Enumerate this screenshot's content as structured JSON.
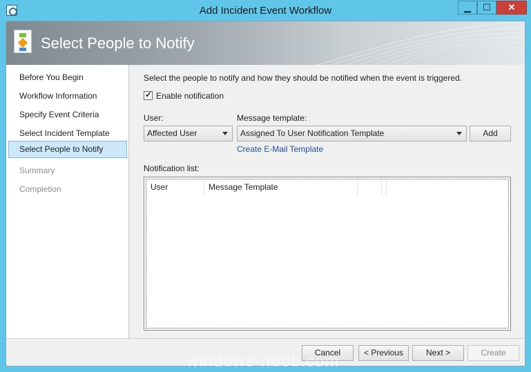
{
  "window": {
    "title": "Add Incident Event Workflow",
    "controls": {
      "minimize": "▁",
      "maximize": "☐",
      "close": "✕"
    }
  },
  "banner": {
    "title": "Select People to Notify"
  },
  "nav": {
    "items": [
      {
        "label": "Before You Begin",
        "state": "normal"
      },
      {
        "label": "Workflow Information",
        "state": "normal"
      },
      {
        "label": "Specify Event Criteria",
        "state": "normal"
      },
      {
        "label": "Select Incident Template",
        "state": "normal"
      },
      {
        "label": "Select People to Notify",
        "state": "active"
      },
      {
        "label": "Summary",
        "state": "disabled"
      },
      {
        "label": "Completion",
        "state": "disabled"
      }
    ]
  },
  "main": {
    "description": "Select the people to notify and how they should be notified when the event is triggered.",
    "enable_notification": {
      "label": "Enable notification",
      "checked": true
    },
    "user_label": "User:",
    "user_value": "Affected User",
    "template_label": "Message template:",
    "template_value": "Assigned To User Notification Template",
    "add_label": "Add",
    "create_template_link": "Create E-Mail Template",
    "notification_list_label": "Notification list:",
    "columns": [
      "User",
      "Message Template",
      "",
      ""
    ]
  },
  "footer": {
    "cancel": "Cancel",
    "previous": "< Previous",
    "next": "Next >",
    "create": "Create"
  },
  "watermark": "windows-noob.com",
  "colors": {
    "titlebar": "#5fc6ea",
    "active_nav": "#cde8fb",
    "link": "#1a4f9c",
    "close_button": "#c9413a"
  }
}
